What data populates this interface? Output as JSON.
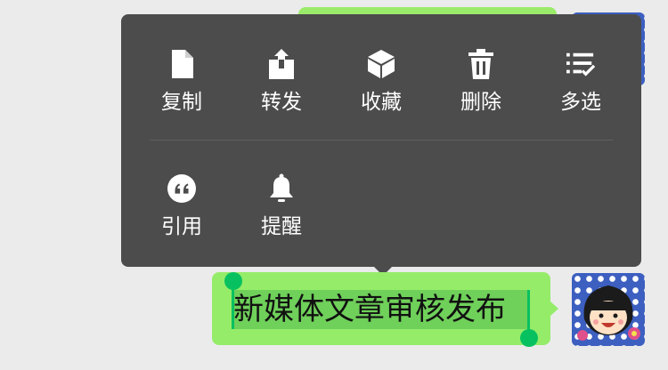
{
  "context_menu": {
    "row1": [
      {
        "label": "复制",
        "icon": "document-icon"
      },
      {
        "label": "转发",
        "icon": "share-icon"
      },
      {
        "label": "收藏",
        "icon": "cube-icon"
      },
      {
        "label": "删除",
        "icon": "trash-icon"
      },
      {
        "label": "多选",
        "icon": "multi-select-icon"
      }
    ],
    "row2": [
      {
        "label": "引用",
        "icon": "quote-icon"
      },
      {
        "label": "提醒",
        "icon": "bell-icon"
      }
    ]
  },
  "message": {
    "text": "新媒体文章审核发布",
    "selected": true
  },
  "colors": {
    "menu_background": "#4c4c4c",
    "bubble": "#95ec69",
    "selection_handle": "#07c160"
  }
}
